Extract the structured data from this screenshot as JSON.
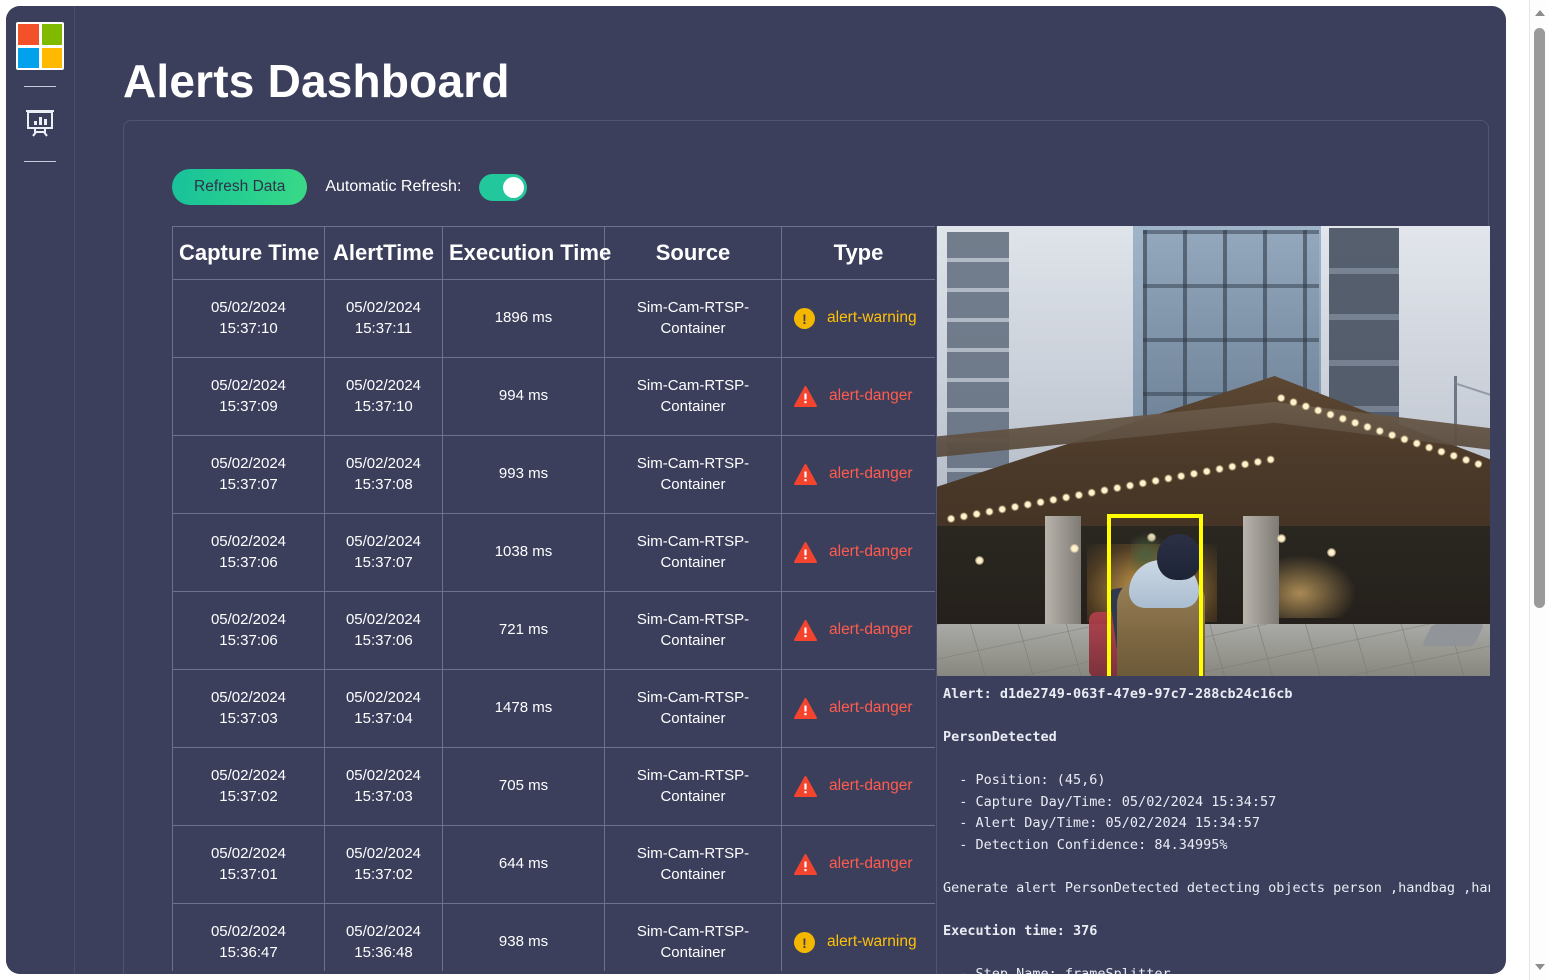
{
  "app": {
    "title": "Alerts Dashboard",
    "accent_teal": "#22c79b",
    "bg": "#3b3f5c",
    "warning_color": "#ffc107",
    "danger_color": "#ff5c4d",
    "bbox_color": "#ffff00"
  },
  "sidebar": {
    "logo_name": "microsoft-logo",
    "logo_tiles": [
      "#f2512a",
      "#7fba00",
      "#00a2ed",
      "#ffb900"
    ],
    "items": [
      {
        "icon": "presentation-chart-icon",
        "label": ""
      }
    ]
  },
  "toolbar": {
    "refresh_label": "Refresh Data",
    "auto_refresh_label": "Automatic Refresh:",
    "auto_refresh_on": true
  },
  "table": {
    "columns": [
      "Capture Time",
      "AlertTime",
      "Execution Time",
      "Source",
      "Type"
    ],
    "rows": [
      {
        "capture_date": "05/02/2024",
        "capture_time": "15:37:10",
        "alert_date": "05/02/2024",
        "alert_time": "15:37:11",
        "execution": "1896 ms",
        "source": "Sim-Cam-RTSP-Container",
        "type": "alert-warning",
        "severity": "warning"
      },
      {
        "capture_date": "05/02/2024",
        "capture_time": "15:37:09",
        "alert_date": "05/02/2024",
        "alert_time": "15:37:10",
        "execution": "994 ms",
        "source": "Sim-Cam-RTSP-Container",
        "type": "alert-danger",
        "severity": "danger"
      },
      {
        "capture_date": "05/02/2024",
        "capture_time": "15:37:07",
        "alert_date": "05/02/2024",
        "alert_time": "15:37:08",
        "execution": "993 ms",
        "source": "Sim-Cam-RTSP-Container",
        "type": "alert-danger",
        "severity": "danger"
      },
      {
        "capture_date": "05/02/2024",
        "capture_time": "15:37:06",
        "alert_date": "05/02/2024",
        "alert_time": "15:37:07",
        "execution": "1038 ms",
        "source": "Sim-Cam-RTSP-Container",
        "type": "alert-danger",
        "severity": "danger"
      },
      {
        "capture_date": "05/02/2024",
        "capture_time": "15:37:06",
        "alert_date": "05/02/2024",
        "alert_time": "15:37:06",
        "execution": "721 ms",
        "source": "Sim-Cam-RTSP-Container",
        "type": "alert-danger",
        "severity": "danger"
      },
      {
        "capture_date": "05/02/2024",
        "capture_time": "15:37:03",
        "alert_date": "05/02/2024",
        "alert_time": "15:37:04",
        "execution": "1478 ms",
        "source": "Sim-Cam-RTSP-Container",
        "type": "alert-danger",
        "severity": "danger"
      },
      {
        "capture_date": "05/02/2024",
        "capture_time": "15:37:02",
        "alert_date": "05/02/2024",
        "alert_time": "15:37:03",
        "execution": "705 ms",
        "source": "Sim-Cam-RTSP-Container",
        "type": "alert-danger",
        "severity": "danger"
      },
      {
        "capture_date": "05/02/2024",
        "capture_time": "15:37:01",
        "alert_date": "05/02/2024",
        "alert_time": "15:37:02",
        "execution": "644 ms",
        "source": "Sim-Cam-RTSP-Container",
        "type": "alert-danger",
        "severity": "danger"
      },
      {
        "capture_date": "05/02/2024",
        "capture_time": "15:36:47",
        "alert_date": "05/02/2024",
        "alert_time": "15:36:48",
        "execution": "938 ms",
        "source": "Sim-Cam-RTSP-Container",
        "type": "alert-warning",
        "severity": "warning"
      }
    ]
  },
  "preview": {
    "image_name": "alert-detection-frame",
    "image_description": "Building entrance at dusk with string lights along awning; person in tan coat with light blue hood walking on sidewalk",
    "bounding_box_label": "person-detection-bbox",
    "detail_lines": [
      "Alert: d1de2749-063f-47e9-97c7-288cb24c16cb",
      "",
      "PersonDetected",
      "",
      "  - Position: (45,6)",
      "  - Capture Day/Time: 05/02/2024 15:34:57",
      "  - Alert Day/Time: 05/02/2024 15:34:57",
      "  - Detection Confidence: 84.34995%",
      "",
      "Generate alert PersonDetected detecting objects person ,handbag ,handbag",
      "",
      "Execution time: 376",
      "",
      "  - Step Name: frameSplitter"
    ]
  },
  "scrollbar": {
    "up_icon": "caret-up-icon",
    "down_icon": "caret-down-icon"
  }
}
